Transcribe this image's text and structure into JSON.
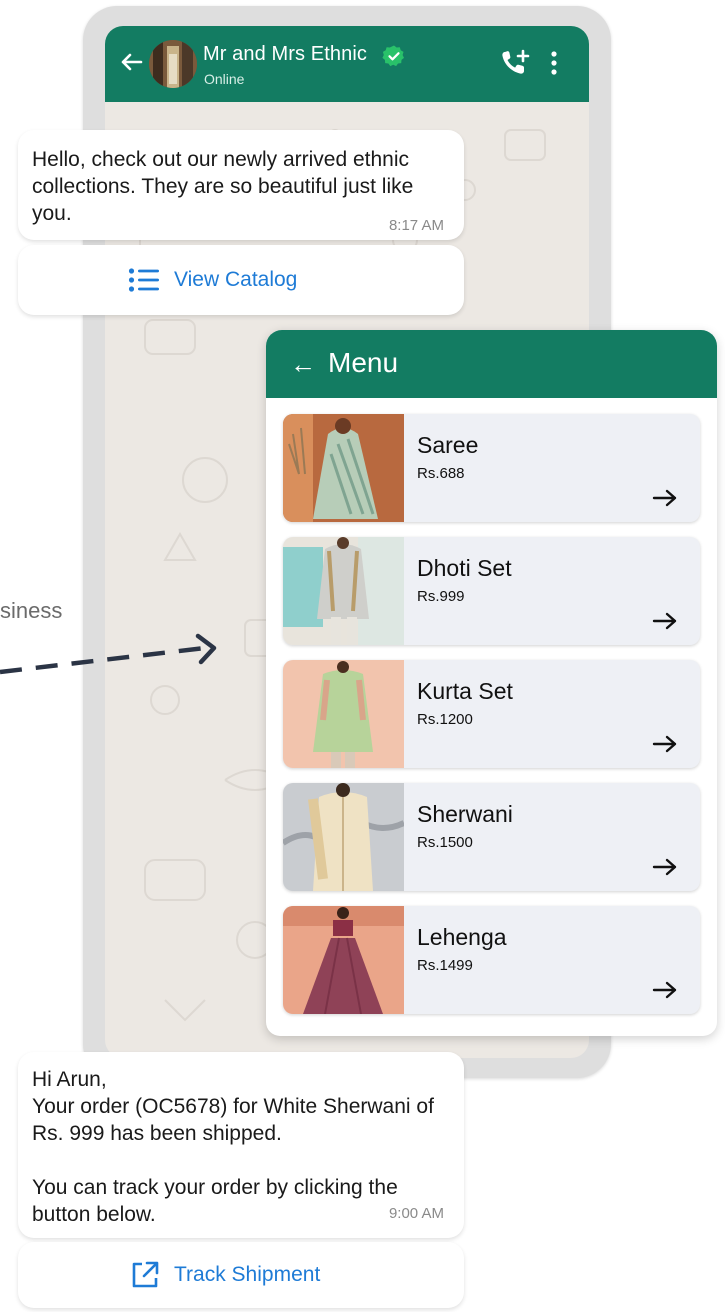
{
  "side_label": "siness",
  "chat": {
    "contact_name": "Mr and Mrs Ethnic",
    "status": "Online",
    "icons": [
      "back-arrow-icon",
      "avatar",
      "verified-badge-icon",
      "add-call-icon",
      "more-vert-icon"
    ]
  },
  "messages": [
    {
      "text": "Hello, check out our newly arrived ethnic collections. They are so beautiful just like you.",
      "time": "8:17 AM",
      "cta": {
        "label": "View Catalog",
        "icon": "list-icon"
      }
    },
    {
      "text": "Hi Arun,\nYour order (OC5678) for White Sherwani of Rs. 999 has been shipped.\n\nYou can track your order by clicking the button below.",
      "time": "9:00 AM",
      "cta": {
        "label": "Track Shipment",
        "icon": "external-link-icon"
      }
    }
  ],
  "menu": {
    "back": "←",
    "title": "Menu",
    "items": [
      {
        "name": "Saree",
        "price": "Rs.688"
      },
      {
        "name": "Dhoti Set",
        "price": "Rs.999"
      },
      {
        "name": "Kurta Set",
        "price": "Rs.1200"
      },
      {
        "name": "Sherwani",
        "price": "Rs.1500"
      },
      {
        "name": "Lehenga",
        "price": "Rs.1499"
      }
    ]
  },
  "colors": {
    "header_green": "#137c62",
    "link_blue": "#1e7bd6",
    "chat_bg": "#ece8e3",
    "menu_item_bg": "#eef0f5"
  }
}
